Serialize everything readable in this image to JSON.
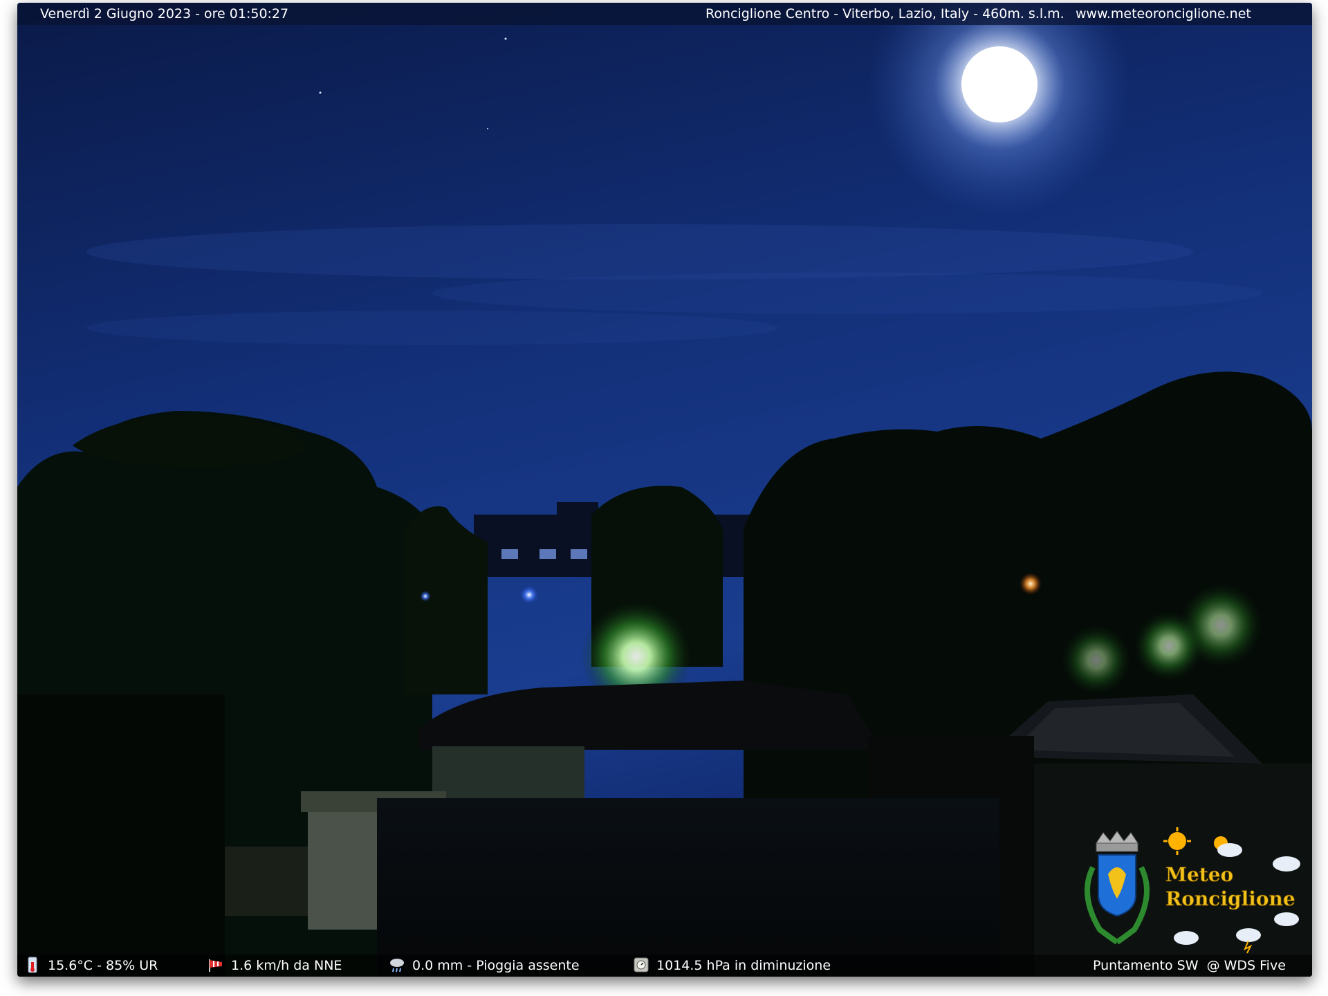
{
  "header": {
    "datetime": "Venerdì 2 Giugno 2023 - ore 01:50:27",
    "location": "Ronciglione Centro - Viterbo, Lazio, Italy - 460m. s.l.m.",
    "website": "www.meteoronciglione.net"
  },
  "footer": {
    "temperature": "15.6°C - 85% UR",
    "wind": "1.6 km/h da NNE",
    "rain": "0.0 mm - Pioggia assente",
    "pressure": "1014.5 hPa in diminuzione",
    "camera": "Puntamento SW  @ WDS Five"
  },
  "logo": {
    "line1": "Meteo",
    "line2": "Ronciglione"
  },
  "icons": {
    "temperature": "thermometer-icon",
    "wind": "windsock-icon",
    "rain": "rain-cloud-icon",
    "pressure": "barometer-icon"
  },
  "colors": {
    "sky_top": "#0b1a4a",
    "sky_mid": "#163a8c",
    "moon": "#ffffff",
    "logo_text": "#f2c21a"
  }
}
